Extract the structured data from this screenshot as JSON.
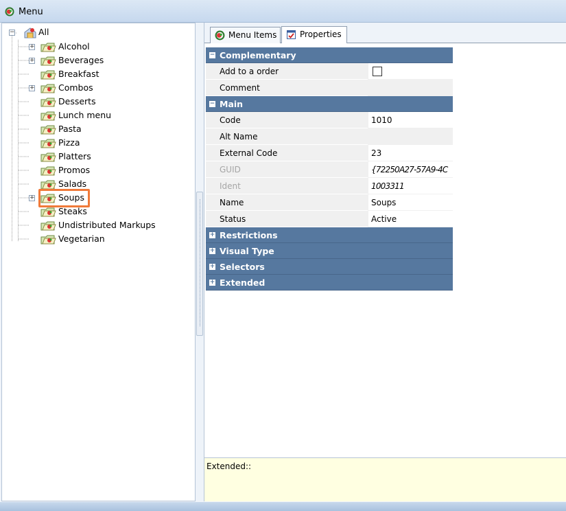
{
  "window": {
    "title": "Menu"
  },
  "tree": {
    "root": "All",
    "items": [
      {
        "label": "Alcohol",
        "expandable": true
      },
      {
        "label": "Beverages",
        "expandable": true
      },
      {
        "label": "Breakfast",
        "expandable": false
      },
      {
        "label": "Combos",
        "expandable": true
      },
      {
        "label": "Desserts",
        "expandable": false
      },
      {
        "label": "Lunch menu",
        "expandable": false
      },
      {
        "label": "Pasta",
        "expandable": false
      },
      {
        "label": "Pizza",
        "expandable": false
      },
      {
        "label": "Platters",
        "expandable": false
      },
      {
        "label": "Promos",
        "expandable": false
      },
      {
        "label": "Salads",
        "expandable": false
      },
      {
        "label": "Soups",
        "expandable": true,
        "selected": true
      },
      {
        "label": "Steaks",
        "expandable": false
      },
      {
        "label": "Undistributed Markups",
        "expandable": false
      },
      {
        "label": "Vegetarian",
        "expandable": false
      }
    ]
  },
  "tabs": [
    {
      "label": "Menu Items",
      "icon": "menu-app-icon"
    },
    {
      "label": "Properties",
      "icon": "properties-icon",
      "active": true
    }
  ],
  "properties": {
    "complementary": {
      "label": "Complementary",
      "rows": [
        {
          "name": "Add to a order",
          "checked": false
        },
        {
          "name": "Comment",
          "value": ""
        }
      ]
    },
    "main": {
      "label": "Main",
      "rows": [
        {
          "name": "Code",
          "value": "1010"
        },
        {
          "name": "Alt Name",
          "value": ""
        },
        {
          "name": "External Code",
          "value": "23"
        },
        {
          "name": "GUID",
          "value": "{72250A27-57A9-4C",
          "disabled": true
        },
        {
          "name": "Ident",
          "value": "1003311",
          "disabled": true
        },
        {
          "name": "Name",
          "value": "Soups"
        },
        {
          "name": "Status",
          "value": "Active"
        }
      ]
    },
    "collapsed": [
      "Restrictions",
      "Visual Type",
      "Selectors",
      "Extended"
    ]
  },
  "description": "Extended::",
  "colors": {
    "category_header": "#56789f",
    "selection_highlight": "#f07a3a",
    "description_bg": "#ffffe1"
  }
}
